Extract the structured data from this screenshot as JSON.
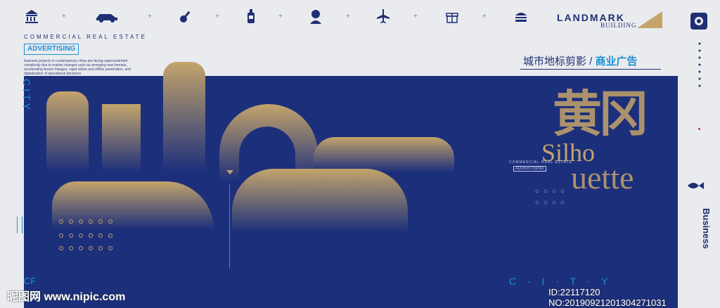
{
  "brand": {
    "landmark": "LANDMARK",
    "building": "BUILDING"
  },
  "left": {
    "commercial": "COMMERCIAL REAL ESTATE",
    "advertising": "ADVERTISING",
    "desc": "business projects in contemporary china are facing unprecedented complexity due to market changes such as emerging new formats, accelerating brand changes, rapid online and offline penetration, and digitalization of operational decisions",
    "city_vertical": "CITY",
    "cf": "CF"
  },
  "headline": {
    "left": "城市地标剪影 / ",
    "right": "商业广告"
  },
  "art": {
    "big_chinese": "黄冈",
    "silho": "Silho",
    "uette": "uette",
    "small_commercial": "COMMERCIAL REAL ESTATE",
    "small_ad": "ADVERTISING",
    "city_spaced": "C · I · T · Y"
  },
  "right": {
    "business": "Business"
  },
  "watermark": {
    "left": "昵图网 www.nipic.com",
    "right": "ID:22117120 NO:20190921201304271031"
  },
  "colors": {
    "navy": "#1c2f7b",
    "gold": "#c4a46b",
    "blue_accent": "#1e8fd6"
  }
}
